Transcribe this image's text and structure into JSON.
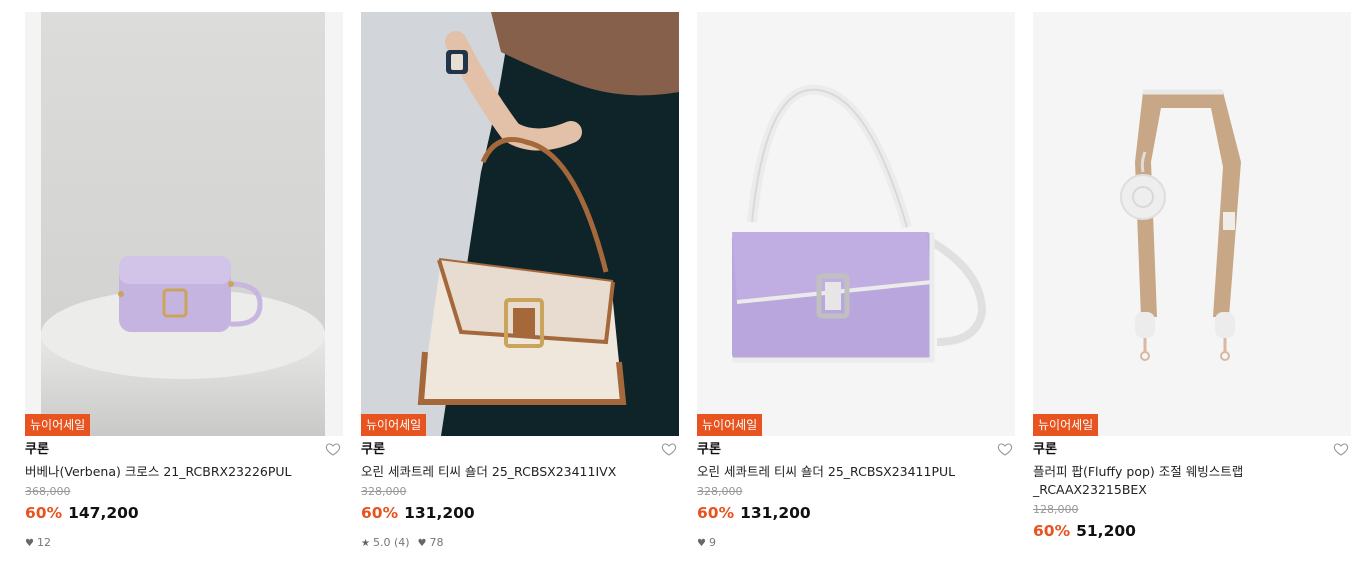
{
  "products": [
    {
      "badge": "뉴이어세일",
      "brand": "쿠론",
      "name": "버베나(Verbena) 크로스 21_RCBRX23226PUL",
      "original_price": "368,000",
      "discount": "60%",
      "price": "147,200",
      "rating": "",
      "likes": "12"
    },
    {
      "badge": "뉴이어세일",
      "brand": "쿠론",
      "name": "오린 세콰트레 티씨 숄더 25_RCBSX23411IVX",
      "original_price": "328,000",
      "discount": "60%",
      "price": "131,200",
      "rating": "5.0 (4)",
      "likes": "78"
    },
    {
      "badge": "뉴이어세일",
      "brand": "쿠론",
      "name": "오린 세콰트레 티씨 숄더 25_RCBSX23411PUL",
      "original_price": "328,000",
      "discount": "60%",
      "price": "131,200",
      "rating": "",
      "likes": "9"
    },
    {
      "badge": "뉴이어세일",
      "brand": "쿠론",
      "name_line1": "플러피 팝(Fluffy pop) 조절 웨빙스트랩",
      "name_line2": "_RCAAX23215BEX",
      "original_price": "128,000",
      "discount": "60%",
      "price": "51,200"
    }
  ],
  "colors": {
    "accent": "#e8541f",
    "lavender": "#b9a6dc",
    "cream": "#efe6dc",
    "tan": "#a4683a"
  },
  "icons": [
    "heart-outline-icon",
    "heart-filled-icon",
    "star-icon"
  ]
}
